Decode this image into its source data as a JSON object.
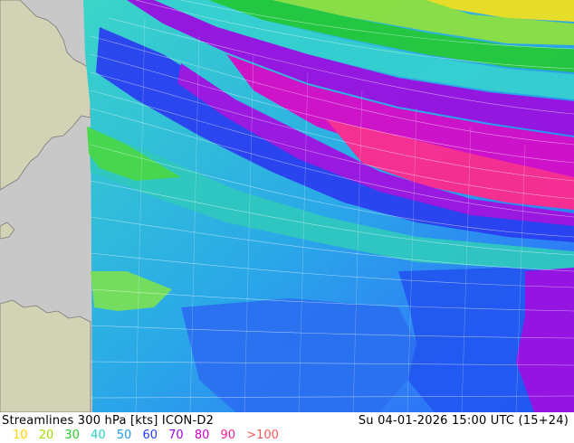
{
  "map": {
    "product": "Streamlines 300 hPa [kts] ICON-D2",
    "valid_time": "Su 04-01-2026 15:00 UTC (15+24)",
    "colors": {
      "sea": "#c8c8c8",
      "land": "#d2d2b4",
      "coast": "#7a7a7a"
    }
  },
  "legend": {
    "items": [
      {
        "label": "10",
        "color": "#ffd400"
      },
      {
        "label": "20",
        "color": "#a0e000"
      },
      {
        "label": "30",
        "color": "#28c828"
      },
      {
        "label": "40",
        "color": "#28d2c8"
      },
      {
        "label": "50",
        "color": "#1e9be6"
      },
      {
        "label": "60",
        "color": "#1e3cff"
      },
      {
        "label": "70",
        "color": "#a000e6"
      },
      {
        "label": "80",
        "color": "#d200d2"
      },
      {
        "label": "90",
        "color": "#ff1e96"
      },
      {
        "label": ">100",
        "color": "#ff5a5a"
      }
    ]
  }
}
